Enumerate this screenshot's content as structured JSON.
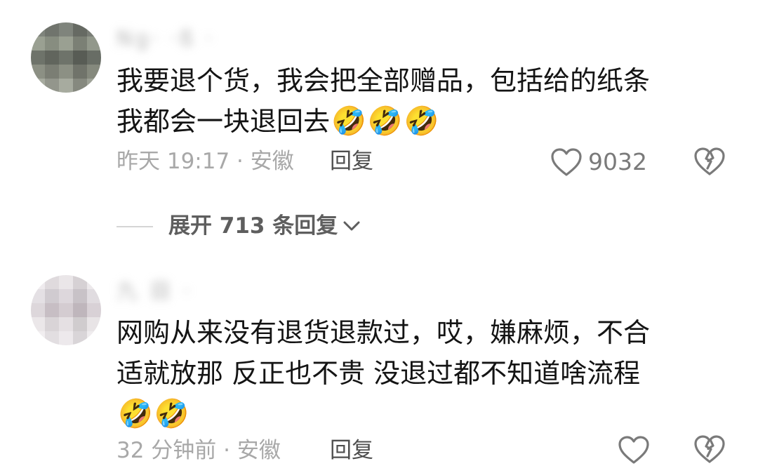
{
  "comments": [
    {
      "username": "Ng· ·ß ·",
      "text_line1": "我要退个货，我会把全部赠品，包括给的纸条",
      "text_line2": "我都会一块退回去",
      "emojis": [
        "🤣",
        "🤣",
        "🤣"
      ],
      "meta": "昨天 19:17 · 安徽",
      "reply_label": "回复",
      "like_count": "9032",
      "icons": {
        "like": "heart-outline-icon",
        "dislike": "broken-heart-icon"
      }
    },
    {
      "username": "九 目 ·",
      "text_line1": "网购从来没有退货退款过，哎，嫌麻烦，不合",
      "text_line2": "适就放那  反正也不贵  没退过都不知道啥流程",
      "emojis": [
        "🤣",
        "🤣"
      ],
      "meta": "32 分钟前 · 安徽",
      "reply_label": "回复",
      "icons": {
        "like": "heart-outline-icon",
        "dislike": "broken-heart-icon"
      }
    }
  ],
  "expand": {
    "label": "展开 713 条回复",
    "icon": "chevron-down-icon"
  },
  "colors": {
    "text": "#141414",
    "meta": "#a8a8a8",
    "reply": "#4f4f4f"
  }
}
